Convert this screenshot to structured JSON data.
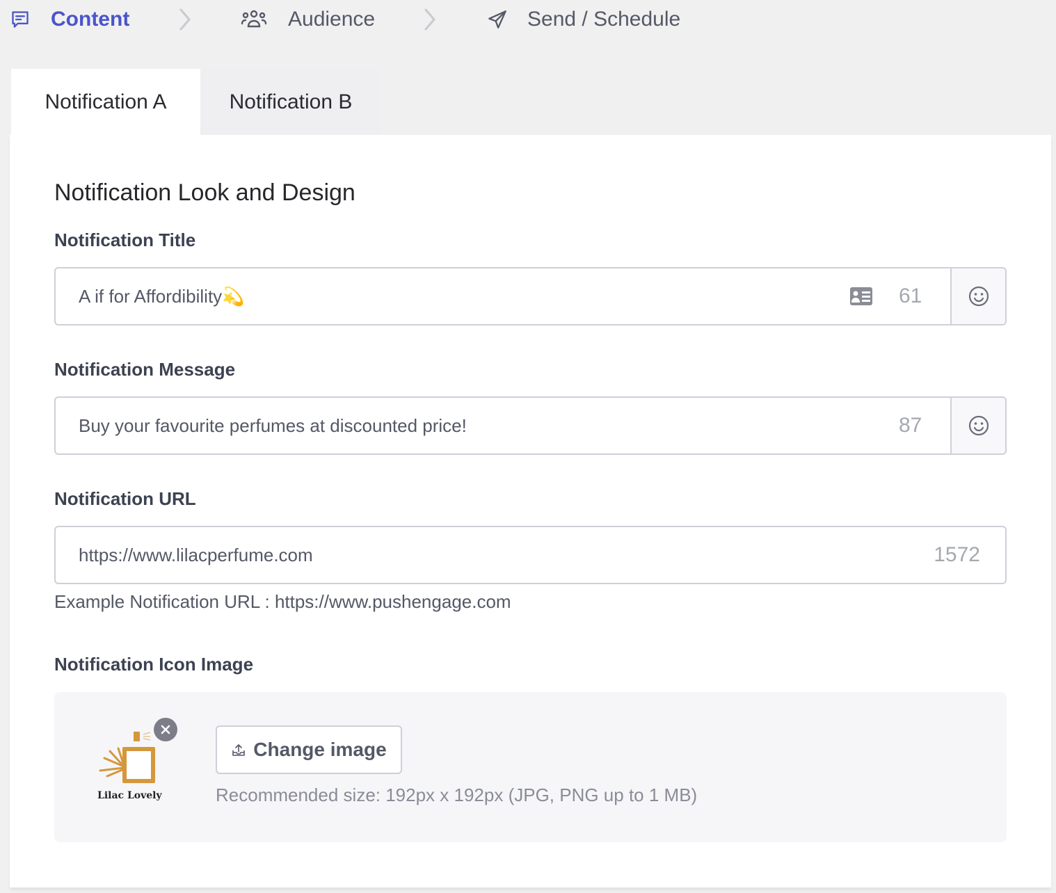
{
  "stepper": {
    "steps": [
      {
        "label": "Content",
        "icon": "message-square-icon",
        "active": true
      },
      {
        "label": "Audience",
        "icon": "users-icon",
        "active": false
      },
      {
        "label": "Send / Schedule",
        "icon": "send-icon",
        "active": false
      }
    ]
  },
  "tabs": [
    {
      "label": "Notification A",
      "active": true
    },
    {
      "label": "Notification B",
      "active": false
    }
  ],
  "section_title": "Notification Look and Design",
  "fields": {
    "title": {
      "label": "Notification Title",
      "value": "A if for Affordibility💫",
      "counter": "61",
      "has_personalize_icon": true,
      "has_emoji_button": true
    },
    "message": {
      "label": "Notification Message",
      "value": "Buy your favourite perfumes at discounted price!",
      "counter": "87",
      "has_emoji_button": true
    },
    "url": {
      "label": "Notification URL",
      "value": "https://www.lilacperfume.com",
      "counter": "1572",
      "hint": "Example Notification URL : https://www.pushengage.com"
    }
  },
  "icon_image": {
    "label": "Notification Icon Image",
    "logo_text": "Lilac Lovely",
    "change_button_label": "Change image",
    "recommendation": "Recommended size: 192px x 192px (JPG, PNG up to 1 MB)"
  },
  "colors": {
    "accent": "#4a55c9",
    "logo_gold": "#d4973b"
  }
}
